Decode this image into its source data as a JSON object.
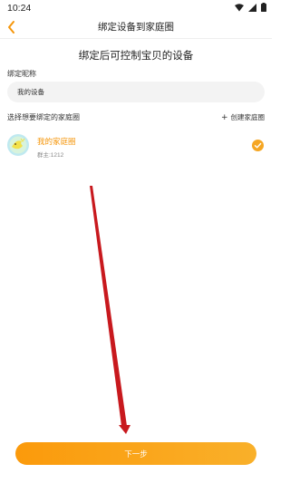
{
  "status_bar": {
    "time": "10:24",
    "icons": [
      "wifi-icon",
      "signal-icon",
      "battery-icon"
    ]
  },
  "nav": {
    "back_icon": "chevron-left-icon",
    "title": "绑定设备到家庭圈"
  },
  "headline": "绑定后可控制宝贝的设备",
  "nickname": {
    "label": "绑定昵称",
    "value": "我的设备"
  },
  "circle_section": {
    "label": "选择想要绑定的家庭圈",
    "create_label": "创建家庭圈",
    "create_icon": "plus-icon"
  },
  "circles": [
    {
      "name": "我的家庭圈",
      "owner": "群主:1212",
      "selected": true
    }
  ],
  "next_button": "下一步",
  "colors": {
    "accent": "#f5960b",
    "button_start": "#fb9a0b",
    "button_end": "#f9b02a",
    "annotation_arrow": "#c8191e"
  }
}
